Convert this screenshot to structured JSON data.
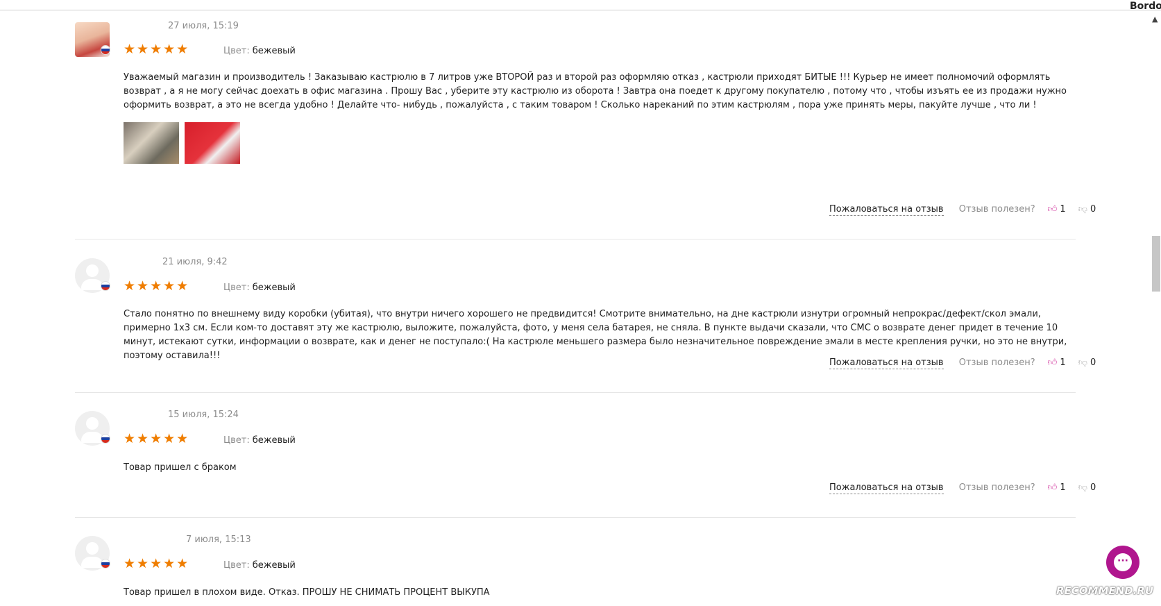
{
  "corner_label": "Bordo",
  "colors": {
    "accent": "#ef7d00",
    "like": "#d23aa0",
    "chat": "#b0168e"
  },
  "reviews": [
    {
      "date": "27 июля, 15:19",
      "stars": "★★★★★",
      "rating": 5,
      "color_label": "Цвет:",
      "color_value": "бежевый",
      "text": "Уважаемый магазин и производитель ! Заказываю кастрюлю в 7 литров уже ВТОРОЙ раз и второй раз оформляю отказ , кастрюли приходят БИТЫЕ !!!  Курьер не имеет полномочий оформлять возврат , а я не могу сейчас доехать в офис магазина . Прошу Вас , уберите эту кастрюлю из оборота ! Завтра она поедет к другому покупателю , потому что , чтобы изъять ее из продажи нужно оформить возврат, а это не всегда удобно ! Делайте что- нибудь , пожалуйста , с таким товаром ! Сколько нареканий по этим  кастрюлям , пора уже принять меры, пакуйте лучше , что ли  !",
      "complain": "Пожаловаться на отзыв",
      "useful": "Отзыв полезен?",
      "likes": "1",
      "dislikes": "0"
    },
    {
      "date": "21 июля, 9:42",
      "stars": "★★★★★",
      "rating": 5,
      "color_label": "Цвет:",
      "color_value": "бежевый",
      "text": "Стало понятно по внешнему виду коробки (убитая), что внутри ничего хорошего не предвидится! Смотрите внимательно, на дне кастрюли изнутри огромный непрокрас/дефект/скол эмали, примерно 1х3 см. Если ком-то доставят эту же кастрюлю, выложите, пожалуйста, фото, у меня села батарея, не сняла. В пункте выдачи сказали, что СМС о возврате денег придет в течение 10 минут, истекают сутки, информации о возврате, как и денег не поступало:( На кастрюле меньшего размера было незначительное повреждение эмали в месте крепления ручки, но это не внутри, поэтому оставила!!!",
      "complain": "Пожаловаться на отзыв",
      "useful": "Отзыв полезен?",
      "likes": "1",
      "dislikes": "0"
    },
    {
      "date": "15 июля, 15:24",
      "stars": "★★★★★",
      "rating": 5,
      "color_label": "Цвет:",
      "color_value": "бежевый",
      "text": "Товар пришел с браком",
      "complain": "Пожаловаться на отзыв",
      "useful": "Отзыв полезен?",
      "likes": "1",
      "dislikes": "0"
    },
    {
      "date": "7 июля, 15:13",
      "stars": "★★★★★",
      "rating": 5,
      "color_label": "Цвет:",
      "color_value": "бежевый",
      "text": "Товар пришел в плохом виде. Отказ. ПРОШУ НЕ СНИМАТЬ ПРОЦЕНТ ВЫКУПА"
    }
  ],
  "watermark": "RECOMMEND.RU"
}
